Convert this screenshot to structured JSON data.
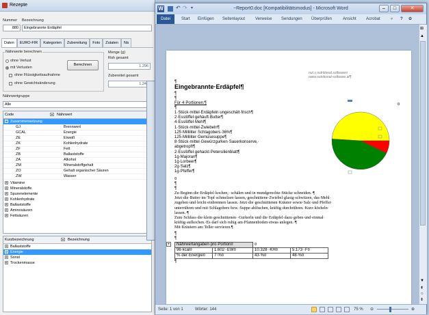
{
  "left_app": {
    "title": "Rezepte",
    "fields": {
      "nummer_label": "Nummer",
      "bezeichnung_label": "Bezeichnung",
      "nummer_value": "880",
      "bezeichnung_value": "Eingebrannte Erdäpfel"
    },
    "tabs": [
      "Daten",
      "EURO-FIR",
      "Kategorien",
      "Zubereitung",
      "Foto",
      "Zutaten",
      "Nä"
    ],
    "naehrwerte": {
      "group_label": "Nährwerte berechnen",
      "radio1": "ohne Verlust",
      "radio2": "mit Verlusten",
      "check1": "ohne Flüssigkeitsaufnahme",
      "check2": "ohne Gewichtsänderung",
      "button": "Berechnen"
    },
    "menge": {
      "label": "Menge (g)",
      "roh_label": "Roh gesamt",
      "roh_value": "1.296",
      "zub_label": "Zubereitet gesamt",
      "zub_value": "1.249"
    },
    "gruppe_label": "Nährwertgruppe",
    "gruppe_value": "Alle",
    "table1": {
      "col1": "Code",
      "col2": "Nährwert",
      "selected_group": "Zusammensetzung",
      "rows": [
        {
          "code": "GJ",
          "name": "Brennwert"
        },
        {
          "code": "GCAL",
          "name": "Energie"
        },
        {
          "code": "ZE",
          "name": "Eiweiß"
        },
        {
          "code": "ZK",
          "name": "Kohlenhydrate"
        },
        {
          "code": "ZF",
          "name": "Fett"
        },
        {
          "code": "ZB",
          "name": "Ballaststoffe"
        },
        {
          "code": "ZA",
          "name": "Alkohol"
        },
        {
          "code": "ZM",
          "name": "Mineralstoffgehalt"
        },
        {
          "code": "ZO",
          "name": "Gehalt organischer Säuren"
        },
        {
          "code": "ZW",
          "name": "Wasser"
        }
      ],
      "groups": [
        "Vitamine",
        "Mineralstoffe",
        "Spurenelemente",
        "Kohlenhydrate",
        "Ballaststoffe",
        "Aminosäuren",
        "Fettsäuren"
      ]
    },
    "table2": {
      "col1": "Kurzbezeichnung",
      "col2": "Bezeichnung",
      "rows": [
        "Ballaststoffe",
        "Energie",
        "Sonst",
        "Trockenmasse"
      ],
      "selected": "Energie"
    }
  },
  "word": {
    "title": "~Report0.doc [Kompatibilitätsmodus] - Microsoft Word",
    "tabs": [
      "Datei",
      "Start",
      "Einfügen",
      "Seitenlayout",
      "Verweise",
      "Sendungen",
      "Überprüfen",
      "Ansicht",
      "Acrobat"
    ],
    "logo_line1": "nut.s nutritional.software¤",
    "logo_line2": "www.nutritional-software.at¶",
    "doc_title": "Eingebrannte·Erdäpfel¶",
    "portions": "Für·4·Portionen:¶",
    "ingredients": [
      "1·Stück·mittel·Erdäpfeln·ungeschält·frisch¶",
      "2·Esslöffel·gehäuft·Butter¶",
      "4·Esslöffel·Mehl¶",
      "1·Stück·mittel·Zwiebeln¶",
      "125·Milliliter·Schlagobers·36%¶",
      "125·Milliliter·Gemüsesuppe¶",
      "8·Stück·mittel·Gewürzgurken·Sauerkonserve,·",
      "abgetropft¶",
      "2·Esslöffel·gehackt·Petersilienblatt¶",
      "1g·Majoran¶",
      "1g·Lorbeer¶",
      "2g·Salz¶",
      "1g·Pfeffer¶"
    ],
    "instructions": [
      "Zu·Beginn·die·Erdäpfel·kochen,··schälen·und·in·mundgerechte·Stücke·schneiden.·¶",
      "Jetzt·die·Butter·im·Topf·schmelzen·lassen,·geschnittene·Zwiebel·glasig·schwitzen,·das·Mehl·",
      "zugeben·und·leicht·einbrennen·lassen.·Jetzt·die·geschnittenen·Kräuter·sowie·Salz·und·Pfeffer·",
      "unterrühren·und·mit·Schlagobers·bzw.·Suppe·ablöschen,·kräftig·durchrühren.·Kurz·köcheln·",
      "lassen.·¶",
      "Zum·Schluss·die·klein·geschnittenen··Gurkerln·und·die·Erdäpfel·dazu·geben·und·einmal·",
      "kräftig·aufkochen.·Es·darf·sich·ruhig·am·Pfannenboden·etwas·anlegen.·¶",
      "Mit·Kräutern·am·Teller·servieren.¶"
    ],
    "table_header": "Nährwertangaben·pro·Portion¤",
    "table_rows": [
      [
        "96·kcal¤",
        "1.602··EW¤",
        "10.328··KH¤",
        "5.173··F¤"
      ],
      [
        "%·der·Energie¤",
        "7·%¤",
        "43·%¤",
        "48·%¤"
      ]
    ],
    "status_page": "Seite: 1 von 1",
    "status_words": "Wörter: 144",
    "zoom": "75 %"
  },
  "chart_data": {
    "type": "pie",
    "slices": [
      {
        "label": "",
        "value": 48,
        "color": "#ffff00"
      },
      {
        "label": "",
        "value": 7,
        "color": "#ff0000"
      },
      {
        "label": "",
        "value": 43,
        "color": "#008000"
      }
    ],
    "legend": "none"
  }
}
